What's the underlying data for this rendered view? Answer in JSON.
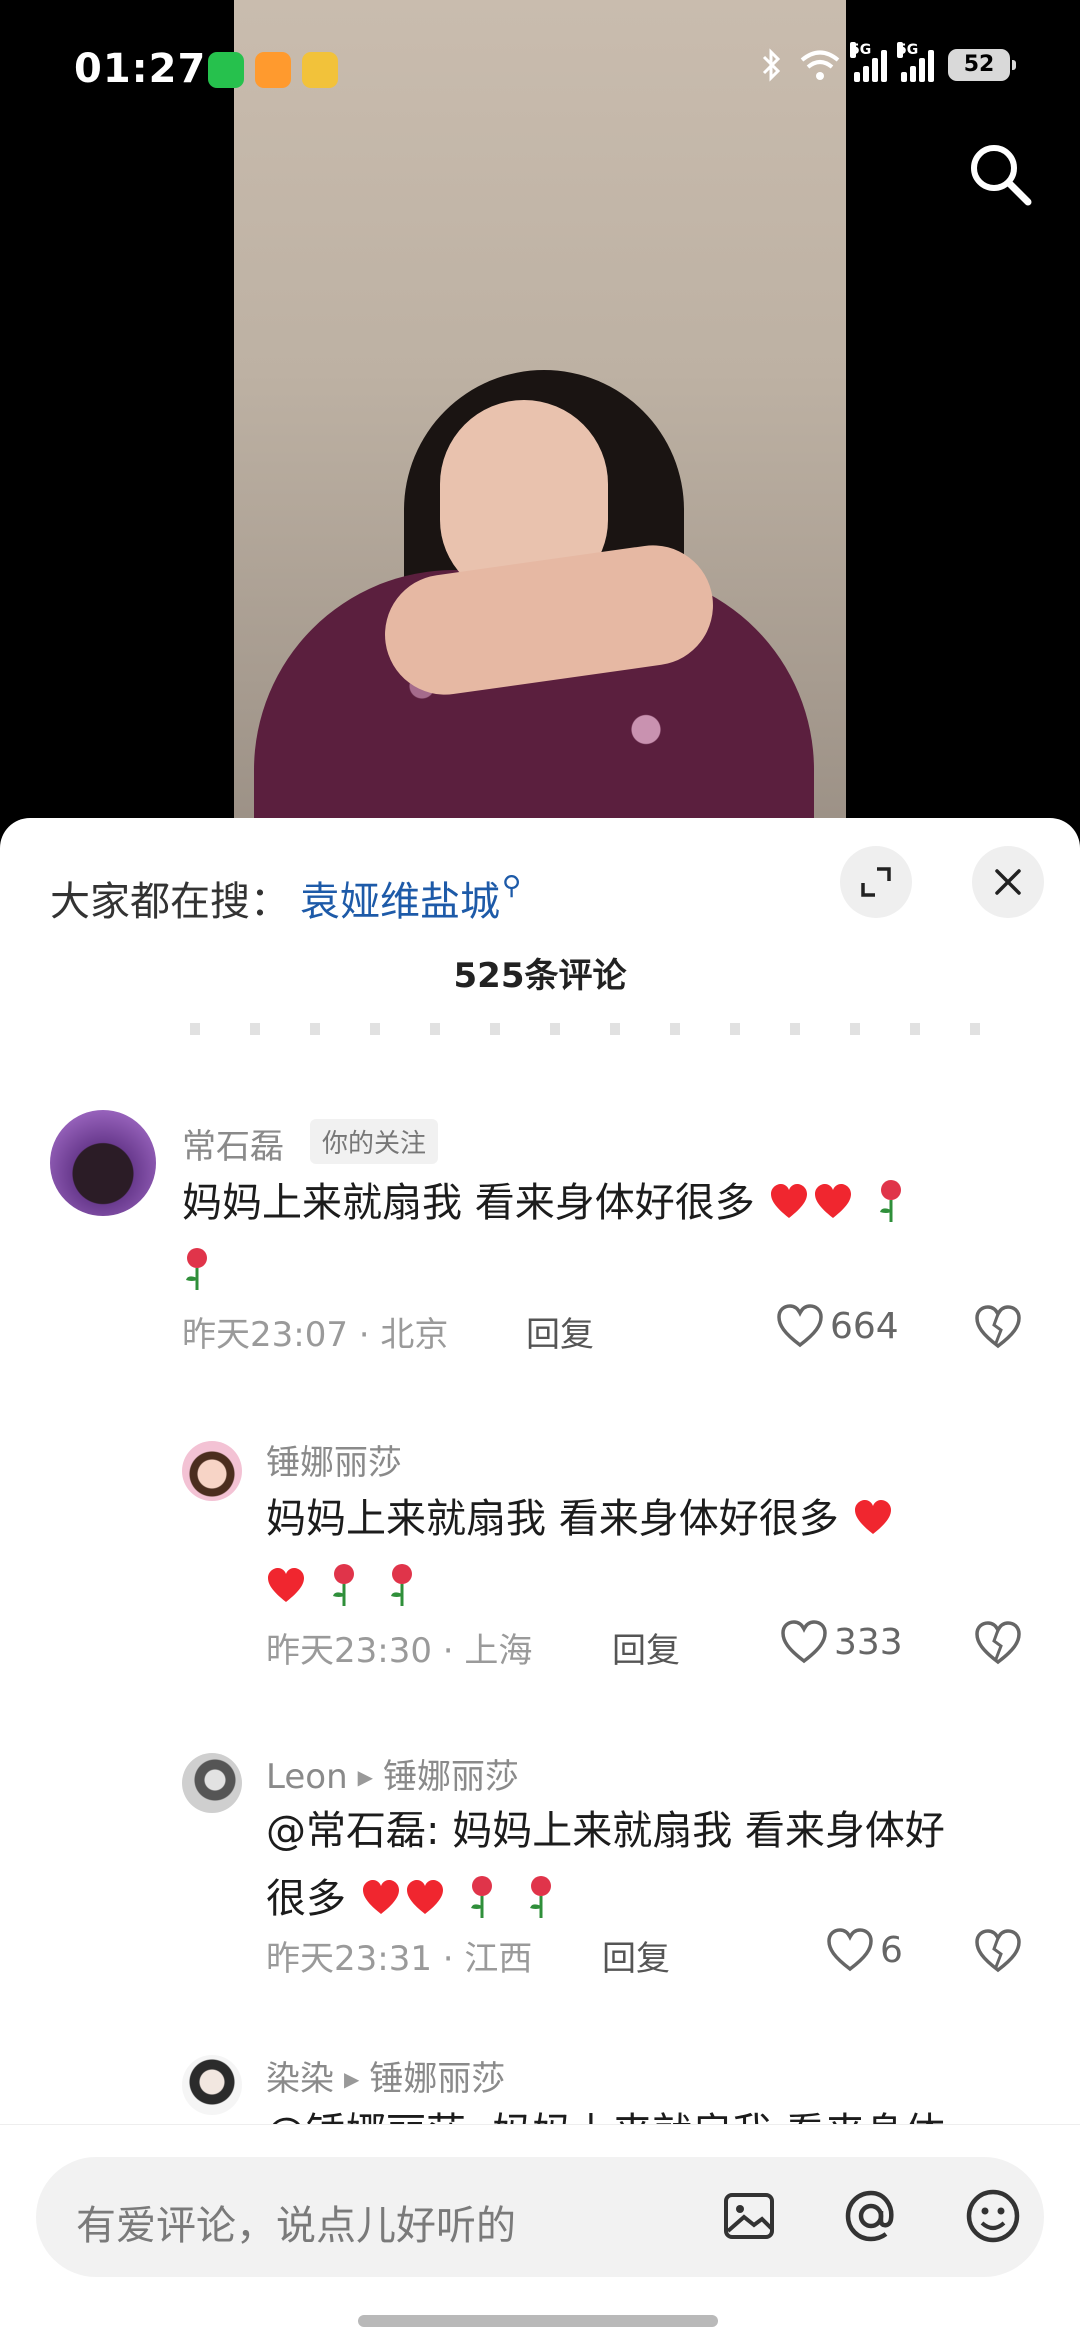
{
  "status_bar": {
    "time": "01:27",
    "network_1": "5G",
    "network_2": "5G",
    "battery": "52"
  },
  "hot_search": {
    "label": "大家都在搜：",
    "term": "袁娅维盐城"
  },
  "comment_count": "525条评论",
  "comments": [
    {
      "username": "常石磊",
      "tag": "你的关注",
      "text": "妈妈上来就扇我 看来身体好很多",
      "time_location": "昨天23:07 · 北京",
      "reply_label": "回复",
      "likes": "664"
    },
    {
      "username": "锤娜丽莎",
      "text": "妈妈上来就扇我 看来身体好很多",
      "time_location": "昨天23:30 · 上海",
      "reply_label": "回复",
      "likes": "333"
    },
    {
      "username": "Leon",
      "reply_to": "锤娜丽莎",
      "text_line1": "@常石磊: 妈妈上来就扇我 看来身体好",
      "text_line2": "很多",
      "time_location": "昨天23:31 · 江西",
      "reply_label": "回复",
      "likes": "6"
    },
    {
      "username": "染染",
      "reply_to": "锤娜丽莎",
      "text": "@锤娜丽莎: 妈妈上来就扇我 看来身体"
    }
  ],
  "input": {
    "placeholder": "有爱评论，说点儿好听的"
  },
  "colors": {
    "accent_link": "#1d5aa8",
    "heart_red": "#f0262f"
  }
}
